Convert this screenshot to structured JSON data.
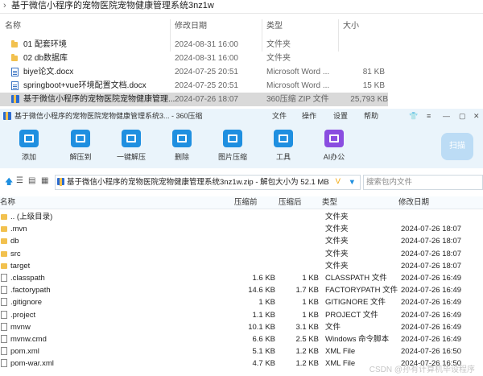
{
  "explorer": {
    "path": "基于微信小程序的宠物医院宠物健康管理系统3nz1w",
    "columns": {
      "name": "名称",
      "date": "修改日期",
      "type": "类型",
      "size": "大小"
    },
    "rows": [
      {
        "icon": "folder-icon",
        "name": "01 配套环境",
        "date": "2024-08-31 16:00",
        "type": "文件夹",
        "size": ""
      },
      {
        "icon": "folder-icon",
        "name": "02 db数据库",
        "date": "2024-08-31 16:00",
        "type": "文件夹",
        "size": ""
      },
      {
        "icon": "word-doc-icon",
        "name": "biye论文.docx",
        "date": "2024-07-25 20:51",
        "type": "Microsoft Word ...",
        "size": "81 KB"
      },
      {
        "icon": "word-doc-icon",
        "name": "springboot+vue环境配置文档.docx",
        "date": "2024-07-25 20:51",
        "type": "Microsoft Word ...",
        "size": "15 KB"
      },
      {
        "icon": "zip-icon",
        "name": "基于微信小程序的宠物医院宠物健康管理...",
        "date": "2024-07-26 18:07",
        "type": "360压缩 ZIP 文件",
        "size": "25,793 KB"
      }
    ]
  },
  "zip": {
    "title": "基于微信小程序的宠物医院宠物健康管理系统3... - 360压缩",
    "menu": [
      "文件",
      "操作",
      "设置",
      "帮助"
    ],
    "toolbar": [
      "添加",
      "解压到",
      "一键解压",
      "删除",
      "图片压缩",
      "工具",
      "AI办公"
    ],
    "scan_label": "扫描",
    "address": "基于微信小程序的宠物医院宠物健康管理系统3nz1w.zip - 解包大小为 52.1 MB",
    "search_placeholder": "搜索包内文件",
    "columns": {
      "name": "名称",
      "packed": "压缩前",
      "compressed": "压缩后",
      "type": "类型",
      "date": "修改日期"
    },
    "rows": [
      {
        "icon": "folder-icon",
        "name": ".. (上级目录)",
        "packed": "",
        "compressed": "",
        "type": "文件夹",
        "date": ""
      },
      {
        "icon": "folder-icon",
        "name": ".mvn",
        "packed": "",
        "compressed": "",
        "type": "文件夹",
        "date": "2024-07-26 18:07"
      },
      {
        "icon": "folder-icon",
        "name": "db",
        "packed": "",
        "compressed": "",
        "type": "文件夹",
        "date": "2024-07-26 18:07"
      },
      {
        "icon": "folder-icon",
        "name": "src",
        "packed": "",
        "compressed": "",
        "type": "文件夹",
        "date": "2024-07-26 18:07"
      },
      {
        "icon": "folder-icon",
        "name": "target",
        "packed": "",
        "compressed": "",
        "type": "文件夹",
        "date": "2024-07-26 18:07"
      },
      {
        "icon": "file-icon",
        "name": ".classpath",
        "packed": "1.6 KB",
        "compressed": "1 KB",
        "type": "CLASSPATH 文件",
        "date": "2024-07-26 16:49"
      },
      {
        "icon": "file-icon",
        "name": ".factorypath",
        "packed": "14.6 KB",
        "compressed": "1.7 KB",
        "type": "FACTORYPATH 文件",
        "date": "2024-07-26 16:49"
      },
      {
        "icon": "file-icon",
        "name": ".gitignore",
        "packed": "1 KB",
        "compressed": "1 KB",
        "type": "GITIGNORE 文件",
        "date": "2024-07-26 16:49"
      },
      {
        "icon": "file-icon",
        "name": ".project",
        "packed": "1.1 KB",
        "compressed": "1 KB",
        "type": "PROJECT 文件",
        "date": "2024-07-26 16:49"
      },
      {
        "icon": "file-icon",
        "name": "mvnw",
        "packed": "10.1 KB",
        "compressed": "3.1 KB",
        "type": "文件",
        "date": "2024-07-26 16:49"
      },
      {
        "icon": "file-icon",
        "name": "mvnw.cmd",
        "packed": "6.6 KB",
        "compressed": "2.5 KB",
        "type": "Windows 命令脚本",
        "date": "2024-07-26 16:49"
      },
      {
        "icon": "file-icon",
        "name": "pom.xml",
        "packed": "5.1 KB",
        "compressed": "1.2 KB",
        "type": "XML File",
        "date": "2024-07-26 16:50"
      },
      {
        "icon": "file-icon",
        "name": "pom-war.xml",
        "packed": "4.7 KB",
        "compressed": "1.2 KB",
        "type": "XML File",
        "date": "2024-07-26 16:50"
      }
    ]
  },
  "watermark": "CSDN @孙有计算机毕设程序"
}
